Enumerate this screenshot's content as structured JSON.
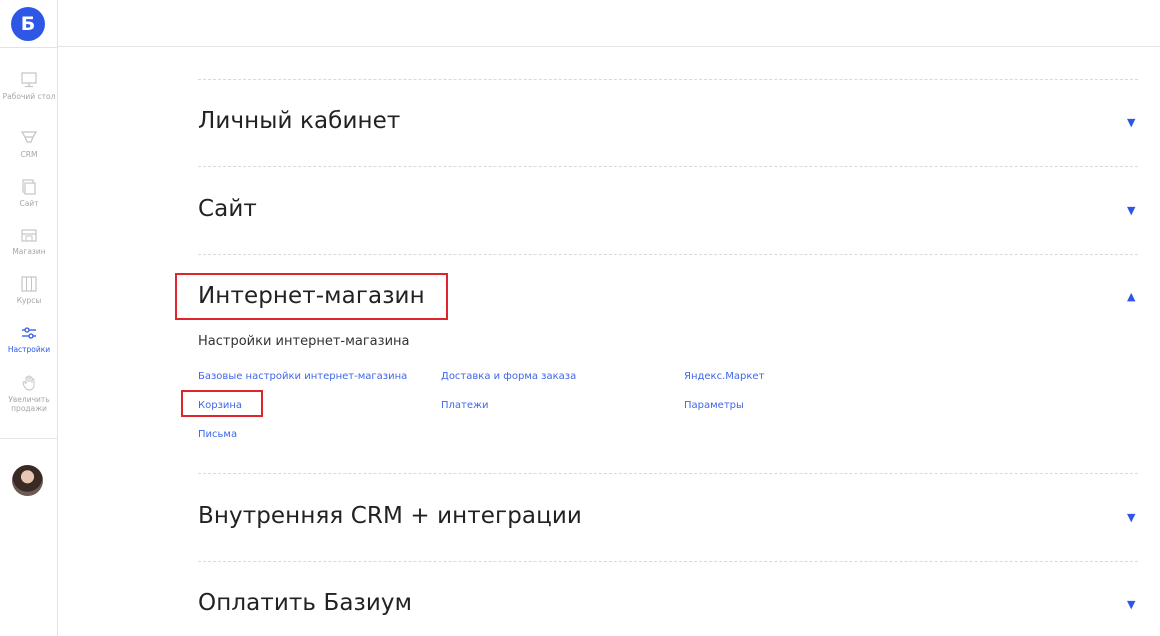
{
  "brand": {
    "logo_letter": "Б",
    "accent": "#2f57e6",
    "highlight": "#e0242b"
  },
  "sidebar": {
    "items": [
      {
        "label": "Рабочий стол",
        "icon": "monitor-icon"
      },
      {
        "label": "CRM",
        "icon": "funnel-icon"
      },
      {
        "label": "Сайт",
        "icon": "pages-icon"
      },
      {
        "label": "Магазин",
        "icon": "store-icon"
      },
      {
        "label": "Курсы",
        "icon": "courses-icon"
      },
      {
        "label": "Настройки",
        "icon": "sliders-icon",
        "active": true
      },
      {
        "label": "Увеличить продажи",
        "icon": "hand-icon"
      }
    ]
  },
  "sections": [
    {
      "title": "Личный кабинет",
      "expanded": false,
      "arrow": "▼"
    },
    {
      "title": "Сайт",
      "expanded": false,
      "arrow": "▼"
    },
    {
      "title": "Интернет-магазин",
      "expanded": true,
      "arrow": "▲",
      "subtitle": "Настройки интернет-магазина",
      "links": [
        "Базовые настройки интернет-магазина",
        "Доставка и форма заказа",
        "Яндекс.Маркет",
        "Корзина",
        "Платежи",
        "Параметры",
        "Письма"
      ]
    },
    {
      "title": "Внутренняя CRM + интеграции",
      "expanded": false,
      "arrow": "▼"
    },
    {
      "title": "Оплатить Базиум",
      "expanded": false,
      "arrow": "▼"
    }
  ]
}
